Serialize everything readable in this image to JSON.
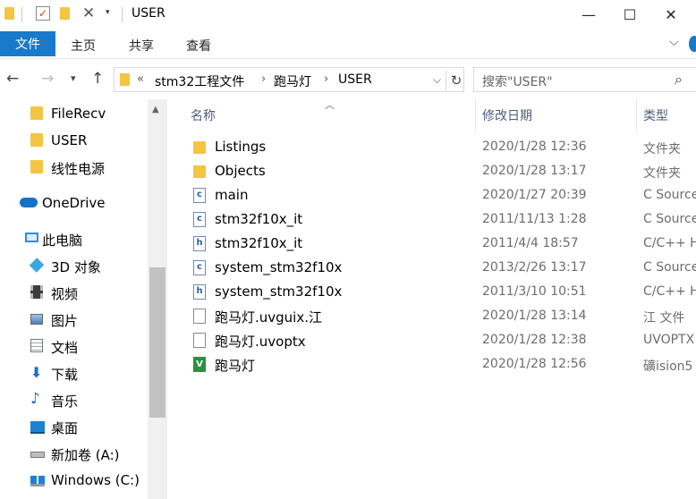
{
  "window": {
    "title": "USER",
    "minimize": "—",
    "maximize": "☐",
    "close": "✕"
  },
  "ribbon": {
    "tabs": [
      "文件",
      "主页",
      "共享",
      "查看"
    ],
    "expand_icon": "chevron-down"
  },
  "address": {
    "overflow": "«",
    "crumbs": [
      "stm32工程文件",
      "跑马灯",
      "USER"
    ],
    "separator": "›"
  },
  "search": {
    "placeholder": "搜索\"USER\""
  },
  "sidebar": {
    "items": [
      {
        "label": "FileRecv",
        "icon": "folder-icon"
      },
      {
        "label": "USER",
        "icon": "folder-icon"
      },
      {
        "label": "线性电源",
        "icon": "folder-icon"
      },
      {
        "label": "OneDrive",
        "icon": "cloud-icon"
      },
      {
        "label": "此电脑",
        "icon": "computer-icon"
      },
      {
        "label": "3D 对象",
        "icon": "cube-icon"
      },
      {
        "label": "视频",
        "icon": "video-icon"
      },
      {
        "label": "图片",
        "icon": "pictures-icon"
      },
      {
        "label": "文档",
        "icon": "document-icon"
      },
      {
        "label": "下载",
        "icon": "download-icon"
      },
      {
        "label": "音乐",
        "icon": "music-icon"
      },
      {
        "label": "桌面",
        "icon": "desktop-icon"
      },
      {
        "label": "新加卷 (A:)",
        "icon": "drive-icon"
      },
      {
        "label": "Windows (C:)",
        "icon": "windows-drive-icon"
      }
    ]
  },
  "columns": {
    "name": "名称",
    "modified": "修改日期",
    "type": "类型"
  },
  "files": [
    {
      "name": "Listings",
      "modified": "2020/1/28 12:36",
      "type": "文件夹",
      "icon": "folder-icon"
    },
    {
      "name": "Objects",
      "modified": "2020/1/28 13:17",
      "type": "文件夹",
      "icon": "folder-icon"
    },
    {
      "name": "main",
      "modified": "2020/1/27 20:39",
      "type": "C Source",
      "icon": "c-source-icon"
    },
    {
      "name": "stm32f10x_it",
      "modified": "2011/11/13 1:28",
      "type": "C Source",
      "icon": "c-source-icon"
    },
    {
      "name": "stm32f10x_it",
      "modified": "2011/4/4 18:57",
      "type": "C/C++ H",
      "icon": "header-file-icon"
    },
    {
      "name": "system_stm32f10x",
      "modified": "2013/2/26 13:17",
      "type": "C Source",
      "icon": "c-source-icon"
    },
    {
      "name": "system_stm32f10x",
      "modified": "2011/3/10 10:51",
      "type": "C/C++ H",
      "icon": "header-file-icon"
    },
    {
      "name": "跑马灯.uvguix.江",
      "modified": "2020/1/28 13:14",
      "type": "江 文件",
      "icon": "blank-file-icon"
    },
    {
      "name": "跑马灯.uvoptx",
      "modified": "2020/1/28 12:38",
      "type": "UVOPTX",
      "icon": "blank-file-icon"
    },
    {
      "name": "跑马灯",
      "modified": "2020/1/28 12:56",
      "type": "礦ision5",
      "icon": "uvision-project-icon"
    }
  ]
}
